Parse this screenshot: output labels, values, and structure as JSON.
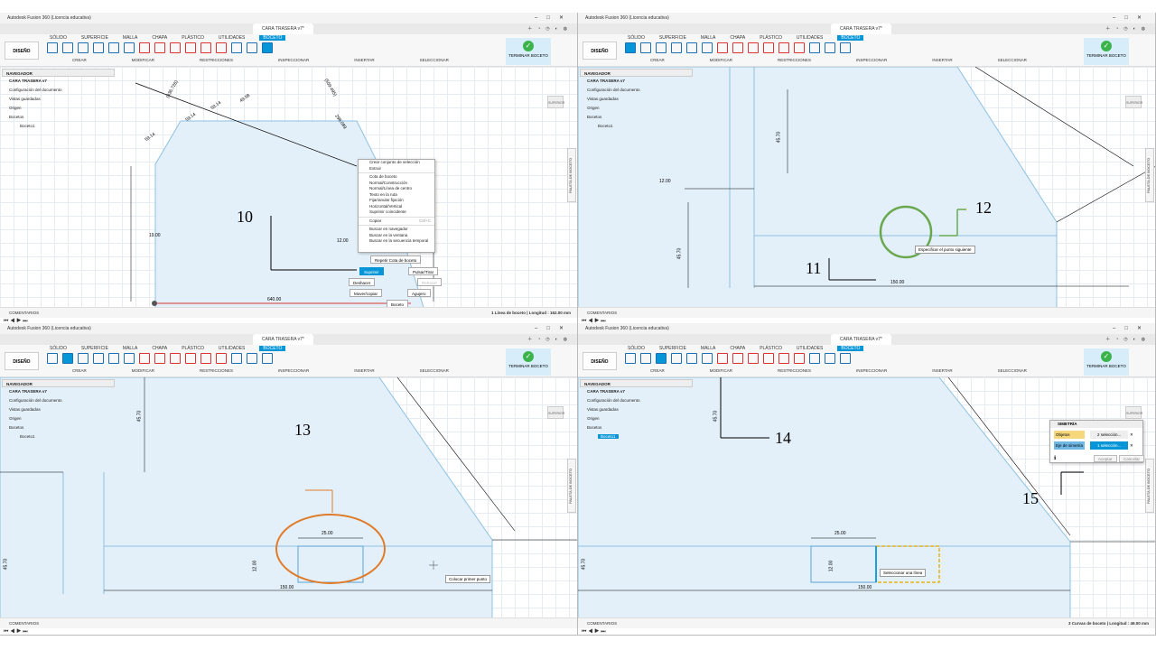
{
  "app": {
    "window_title": "Autodesk Fusion 360 (Licencia educativa)",
    "doc_tab": "CARA TRASERA v7*",
    "workspace": "DISEÑO",
    "tabs": [
      "SÓLIDO",
      "SUPERFICIE",
      "MALLA",
      "CHAPA",
      "PLÁSTICO",
      "UTILIDADES",
      "BOCETO"
    ],
    "groups": [
      "CREAR",
      "MODIFICAR",
      "RESTRICCIONES",
      "INSPECCIONAR",
      "INSERTAR",
      "SELECCIONAR"
    ],
    "finish_label": "TERMINAR BOCETO",
    "navigator_title": "NAVEGADOR",
    "comments_label": "COMENTARIOS",
    "paleta_label": "PALETA DE BOCETO",
    "viewcube_label": "SUPERIOR"
  },
  "navigator": {
    "doc": "CARA TRASERA v7",
    "items": [
      "Configuración del documento",
      "Vistas guardadas",
      "Origen",
      "Bocetos",
      "Boceto1"
    ]
  },
  "panel1": {
    "status": "1 Línea de boceto | Longitud : 162.00 mm",
    "context_menu": [
      "Crear conjunto de selección",
      "Extruir",
      "Cota de boceto",
      "Normal/Construcción",
      "Normal/Línea de centro",
      "Texto en la ruta",
      "Fijar/anular fijación",
      "Horizontal/Vertical",
      "Suprimir coincidente",
      "Copiar",
      "Buscar en navegador",
      "Buscar en la ventana",
      "Buscar en la secuencia temporal"
    ],
    "copy_shortcut": "Ctrl+C",
    "repeat_label": "Repetir Cota de boceto",
    "delete_label": "Suprimir",
    "undo_label": "Deshacer",
    "move_label": "Mover/copiar",
    "pulse_label": "Pulsar/Tirar",
    "hole_label": "Agujero",
    "redo_label": "Rehacer",
    "sketch_dropdown": "Boceto",
    "dims": [
      "640.00",
      "12.00",
      "59.14",
      "59.14",
      "59.14",
      "59.14",
      "49.58",
      "30.55",
      "40.35",
      "298.089",
      "(336.726)",
      "(559.495)",
      "25.10",
      "45.70",
      "19.00",
      "19.00",
      "17.00",
      "12.00",
      "19.00",
      "56.00"
    ],
    "callout": "10"
  },
  "panel2": {
    "tooltip": "Especificar el punto siguiente",
    "dims": [
      "45.70",
      "12.00",
      "45.70",
      "150.00"
    ],
    "callouts": [
      "11",
      "12"
    ]
  },
  "panel3": {
    "tooltip": "Colocar primer punto",
    "dims": [
      "45.70",
      "25.00",
      "12.00",
      "45.70",
      "150.00"
    ],
    "callout": "13"
  },
  "panel4": {
    "tooltip": "Seleccionar una línea",
    "dims": [
      "45.70",
      "25.00",
      "12.00",
      "45.70",
      "150.00"
    ],
    "status": "3 Curvas de boceto | Longitud : 49.00 mm",
    "dialog": {
      "title": "SIMETRÍA",
      "row1_label": "Objetos",
      "row1_value": "2 selección...",
      "row2_label": "Eje de simetría",
      "row2_value": "1 selección...",
      "ok": "Aceptar",
      "cancel": "Cancelar"
    },
    "callouts": [
      "14",
      "15"
    ]
  },
  "colors": {
    "accent": "#0696d7",
    "finish_green": "#3bb34a",
    "sketch_fill": "#e3f0f9",
    "sketch_line": "#8cc1e3",
    "green_circle": "#6aa84f",
    "orange_circle": "#e07b2a"
  }
}
